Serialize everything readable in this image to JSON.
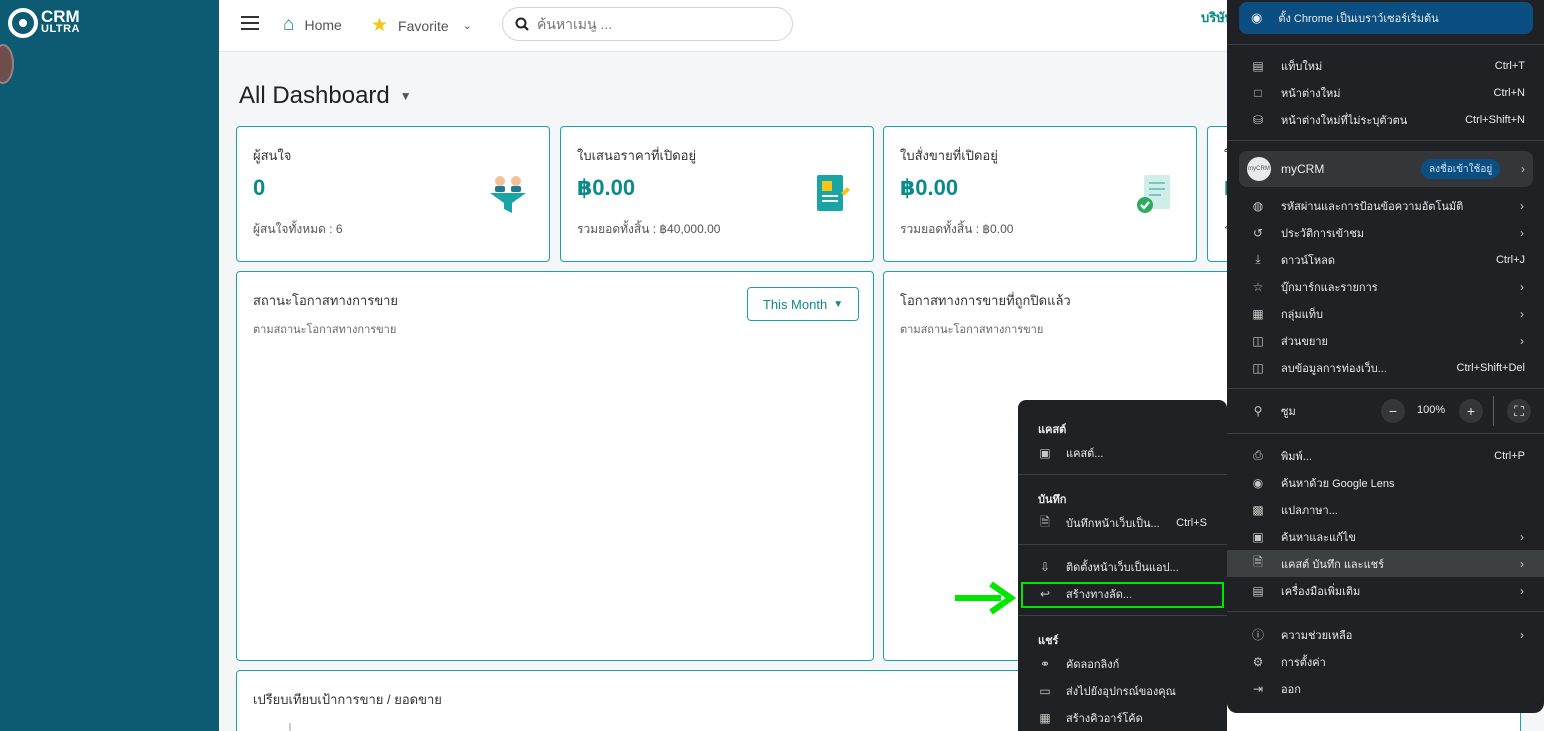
{
  "sidebar": {
    "logo_line1": "CRM",
    "logo_line2": "ULTRA"
  },
  "topbar": {
    "home_label": "Home",
    "favorite_label": "Favorite",
    "search_placeholder": "ค้นหาเมนู ...",
    "company_name": "บริษัท"
  },
  "dashboard": {
    "title": "All Dashboard",
    "cards": [
      {
        "title": "ผู้สนใจ",
        "value": "0",
        "sub": "ผู้สนใจทั้งหมด : 6"
      },
      {
        "title": "ใบเสนอราคาที่เปิดอยู่",
        "value": "฿0.00",
        "sub": "รวมยอดทั้งสิ้น : ฿40,000.00"
      },
      {
        "title": "ใบสั่งขายที่เปิดอยู่",
        "value": "฿0.00",
        "sub": "รวมยอดทั้งสิ้น : ฿0.00"
      },
      {
        "title": "ใ",
        "value": "฿",
        "sub": "ร"
      }
    ],
    "panel_status": {
      "title": "สถานะโอกาสทางการขาย",
      "sub": "ตามสถานะโอกาสทางการขาย",
      "filter": "This Month"
    },
    "panel_closed": {
      "title": "โอกาสทางการขายที่ถูกปิดแล้ว",
      "sub": "ตามสถานะโอกาสทางการขาย"
    },
    "panel_compare": {
      "title": "เปรียบเทียบเป้าการขาย / ยอดขาย"
    }
  },
  "share_menu": {
    "cast_header": "แคสต์",
    "cast_item": "แคสต์...",
    "save_header": "บันทึก",
    "save_page": "บันทึกหน้าเว็บเป็น...",
    "save_page_shortcut": "Ctrl+S",
    "install_app": "ติดตั้งหน้าเว็บเป็นแอป...",
    "create_shortcut": "สร้างทางลัด...",
    "share_header": "แชร์",
    "copy_link": "คัดลอกลิงก์",
    "send_to_devices": "ส่งไปยังอุปกรณ์ของคุณ",
    "create_qr": "สร้างคิวอาร์โค้ด"
  },
  "chrome_menu": {
    "default_browser": "ตั้ง Chrome เป็นเบราว์เซอร์เริ่มต้น",
    "new_tab": "แท็บใหม่",
    "new_tab_sc": "Ctrl+T",
    "new_window": "หน้าต่างใหม่",
    "new_window_sc": "Ctrl+N",
    "incognito": "หน้าต่างใหม่ที่ไม่ระบุตัวตน",
    "incognito_sc": "Ctrl+Shift+N",
    "profile_name": "myCRM",
    "profile_avatar": "myCRM",
    "profile_badge": "ลงชื่อเข้าใช้อยู่",
    "passwords": "รหัสผ่านและการป้อนข้อความอัตโนมัติ",
    "history": "ประวัติการเข้าชม",
    "downloads": "ดาวน์โหลด",
    "downloads_sc": "Ctrl+J",
    "bookmarks": "บุ๊กมาร์กและรายการ",
    "tab_groups": "กลุ่มแท็บ",
    "extensions": "ส่วนขยาย",
    "clear_data": "ลบข้อมูลการท่องเว็บ...",
    "clear_data_sc": "Ctrl+Shift+Del",
    "zoom": "ซูม",
    "zoom_value": "100%",
    "print": "พิมพ์...",
    "print_sc": "Ctrl+P",
    "google_lens": "ค้นหาด้วย Google Lens",
    "translate": "แปลภาษา...",
    "find_edit": "ค้นหาและแก้ไข",
    "cast_save_share": "แคสต์ บันทึก และแชร์",
    "more_tools": "เครื่องมือเพิ่มเติม",
    "help": "ความช่วยเหลือ",
    "settings": "การตั้งค่า",
    "exit": "ออก"
  },
  "colors": {
    "sidebar": "#0c5b73",
    "accent": "#19a5a5",
    "menu_bg": "#202124",
    "highlight": "#00e600"
  }
}
